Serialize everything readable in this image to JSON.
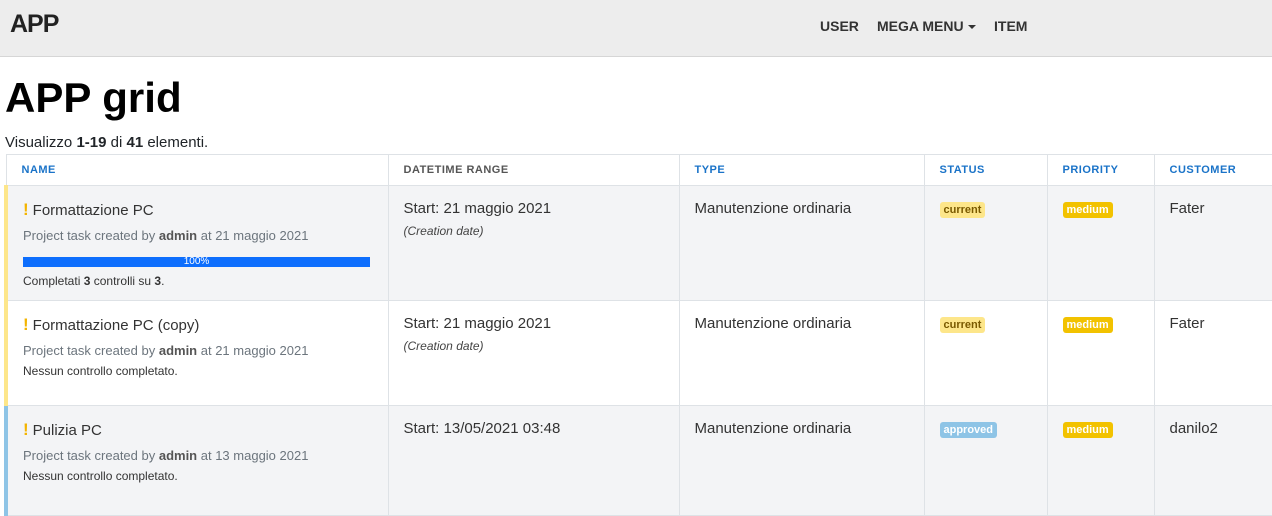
{
  "navbar": {
    "brand": "APP",
    "items": [
      {
        "label": "USER"
      },
      {
        "label": "MEGA MENU"
      },
      {
        "label": "ITEM"
      }
    ]
  },
  "page": {
    "title": "APP grid",
    "summary_prefix": "Visualizzo ",
    "summary_range": "1-19",
    "summary_middle": " di ",
    "summary_total": "41",
    "summary_suffix": " elementi."
  },
  "table": {
    "headers": [
      "NAME",
      "DATETIME RANGE",
      "TYPE",
      "STATUS",
      "PRIORITY",
      "CUSTOMER"
    ],
    "rows": [
      {
        "title": "Formattazione PC",
        "meta_prefix": "Project task created by ",
        "meta_user": "admin",
        "meta_suffix": " at 21 maggio 2021",
        "progress_label": "100%",
        "progress_value": 100,
        "checks_prefix": "Completati ",
        "checks_done": "3",
        "checks_middle": " controlli su ",
        "checks_total": "3",
        "checks_suffix": ".",
        "range": "Start: 21 maggio 2021",
        "range_sub": "(Creation date)",
        "type": "Manutenzione ordinaria",
        "status": "current",
        "priority": "medium",
        "customer": "Fater"
      },
      {
        "title": "Formattazione PC (copy)",
        "meta_prefix": "Project task created by ",
        "meta_user": "admin",
        "meta_suffix": " at 21 maggio 2021",
        "checks_text": "Nessun controllo completato.",
        "range": "Start: 21 maggio 2021",
        "range_sub": "(Creation date)",
        "type": "Manutenzione ordinaria",
        "status": "current",
        "priority": "medium",
        "customer": "Fater"
      },
      {
        "title": "Pulizia PC",
        "meta_prefix": "Project task created by ",
        "meta_user": "admin",
        "meta_suffix": " at 13 maggio 2021",
        "checks_text": "Nessun controllo completato.",
        "range": "Start: 13/05/2021 03:48",
        "type": "Manutenzione ordinaria",
        "status": "approved",
        "priority": "medium",
        "customer": "danilo2"
      }
    ]
  },
  "colors": {
    "header_link": "#1a73c8",
    "status_current": "#fde68a",
    "status_approved": "#8ec4e6",
    "priority_medium": "#f2c200",
    "progress": "#0d6efd"
  },
  "icons": {
    "priority_marker": "exclamation-icon",
    "dropdown": "caret-down-icon"
  }
}
